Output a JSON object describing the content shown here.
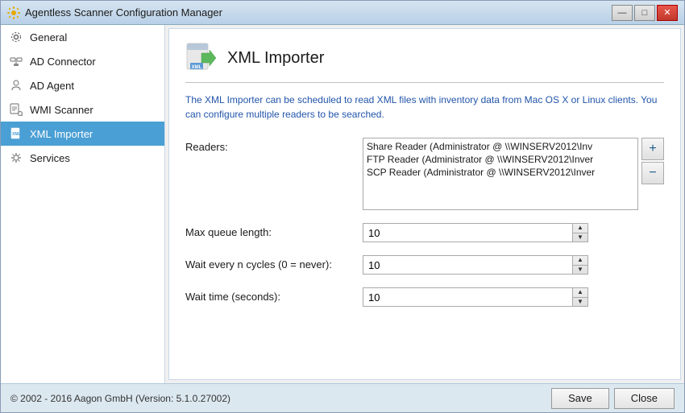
{
  "window": {
    "title": "Agentless Scanner Configuration Manager",
    "controls": {
      "minimize": "—",
      "maximize": "□",
      "close": "✕"
    }
  },
  "sidebar": {
    "items": [
      {
        "id": "general",
        "label": "General",
        "icon": "gear-icon"
      },
      {
        "id": "ad-connector",
        "label": "AD Connector",
        "icon": "connector-icon"
      },
      {
        "id": "ad-agent",
        "label": "AD Agent",
        "icon": "agent-icon"
      },
      {
        "id": "wmi-scanner",
        "label": "WMI Scanner",
        "icon": "scanner-icon"
      },
      {
        "id": "xml-importer",
        "label": "XML Importer",
        "icon": "xml-icon",
        "active": true
      },
      {
        "id": "services",
        "label": "Services",
        "icon": "services-icon"
      }
    ]
  },
  "content": {
    "title": "XML Importer",
    "description": "The XML Importer can be scheduled to read XML files with inventory data from Mac OS X or Linux clients. You can configure multiple readers to be searched.",
    "readers_label": "Readers:",
    "readers": [
      "Share Reader (Administrator @ \\\\WINSERV2012\\Inv",
      "FTP Reader (Administrator @ \\\\WINSERV2012\\Inver",
      "SCP Reader (Administrator @ \\\\WINSERV2012\\Inver"
    ],
    "add_btn": "+",
    "remove_btn": "−",
    "max_queue_label": "Max queue length:",
    "max_queue_value": "10",
    "wait_cycles_label": "Wait every n cycles (0 = never):",
    "wait_cycles_value": "10",
    "wait_time_label": "Wait time (seconds):",
    "wait_time_value": "10"
  },
  "footer": {
    "copyright": "© 2002 - 2016 Aagon GmbH (Version: 5.1.0.27002)",
    "save_label": "Save",
    "close_label": "Close"
  }
}
